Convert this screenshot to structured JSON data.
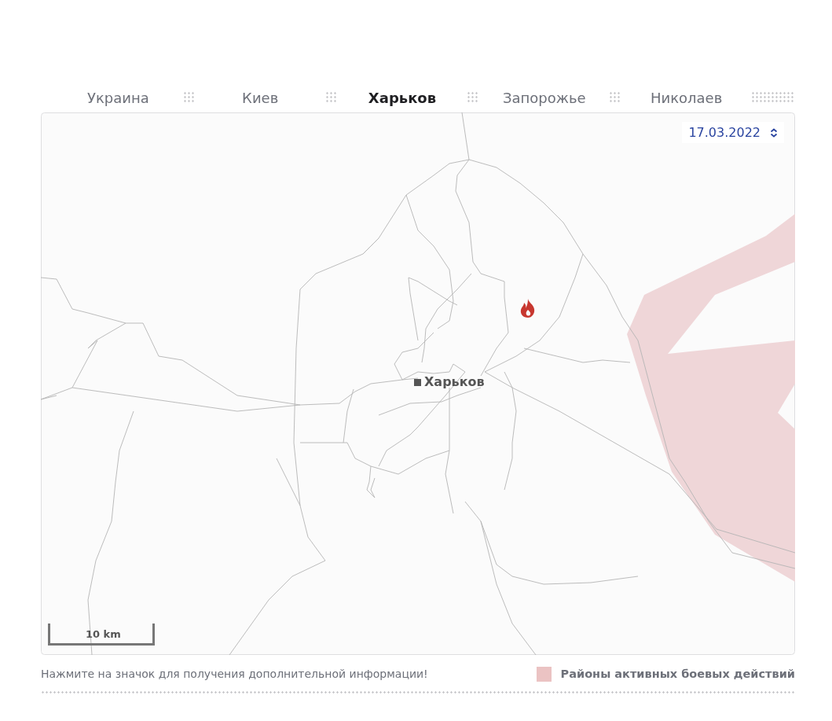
{
  "tabs": [
    {
      "label": "Украина",
      "selected": false
    },
    {
      "label": "Киев",
      "selected": false
    },
    {
      "label": "Харьков",
      "selected": true
    },
    {
      "label": "Запорожье",
      "selected": false
    },
    {
      "label": "Николаев",
      "selected": false
    }
  ],
  "map": {
    "date": "17.03.2022",
    "city_label": "Харьков",
    "scale_label": "10 km"
  },
  "footer": {
    "hint": "Нажмите на значок для получения дополнительной информации!",
    "legend_label": "Районы активных боевых действий"
  }
}
